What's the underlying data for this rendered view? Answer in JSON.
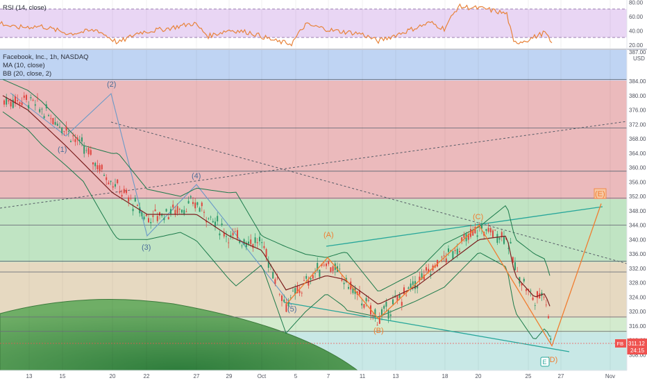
{
  "rsi_panel": {
    "title": "RSI (14, close)",
    "axis_ticks": [
      "80.00",
      "60.00",
      "40.00",
      "20.00"
    ],
    "band_upper": 70,
    "band_lower": 30,
    "colors": {
      "line": "#e8833a",
      "band_fill": "#e9d6f4",
      "band_border": "#9a7fb0"
    }
  },
  "main_panel": {
    "legend": {
      "symbol": "Facebook, Inc., 1h, NASDAQ",
      "ma": "MA (10, close)",
      "bb": "BB (20, close, 2)"
    },
    "currency": "USD",
    "price_ticks": [
      "384.00",
      "380.00",
      "376.00",
      "372.00",
      "368.00",
      "364.00",
      "360.00",
      "356.00",
      "352.00",
      "348.00",
      "344.00",
      "340.00",
      "336.00",
      "332.00",
      "328.00",
      "324.00",
      "320.00",
      "316.00",
      "312.00",
      "308.00"
    ],
    "top_partial_tick": "387.00",
    "x_ticks": [
      "13",
      "15",
      "20",
      "22",
      "27",
      "29",
      "Oct",
      "5",
      "7",
      "11",
      "13",
      "18",
      "20",
      "25",
      "27",
      "Nov"
    ],
    "last_price": {
      "ticker": "FB",
      "value": "311.12",
      "countdown": "24:15"
    },
    "wave_labels": [
      "(1)",
      "(2)",
      "(3)",
      "(4)",
      "(5)",
      "(A)",
      "(B)",
      "(C)",
      "(D)",
      "(E)"
    ],
    "earnings_marker": "E"
  },
  "chart_data": {
    "type": "line",
    "title": "Facebook, Inc., 1h, NASDAQ",
    "ylabel": "USD",
    "ylim": [
      306.5,
      386.5
    ],
    "x": [
      "13",
      "15",
      "20",
      "22",
      "27",
      "29",
      "Oct",
      "5",
      "7",
      "11",
      "13",
      "18",
      "20",
      "25",
      "27",
      "Nov"
    ],
    "series": [
      {
        "name": "price",
        "values": [
          378.5,
          379,
          371,
          356,
          346,
          350,
          341,
          339,
          322,
          334,
          329,
          318,
          328,
          343,
          341,
          332,
          323,
          326,
          310.5
        ]
      },
      {
        "name": "MA (10, close)",
        "values": [
          380,
          376,
          366,
          353,
          347,
          347,
          341,
          337,
          326,
          330,
          329,
          322,
          327,
          340,
          341,
          330,
          324,
          325,
          320
        ]
      }
    ],
    "wave_projection": [
      {
        "label": "(1)",
        "price": 369
      },
      {
        "label": "(2)",
        "price": 381
      },
      {
        "label": "(3)",
        "price": 343
      },
      {
        "label": "(4)",
        "price": 355
      },
      {
        "label": "(5)",
        "price": 322
      },
      {
        "label": "(A)",
        "price": 335
      },
      {
        "label": "(B)",
        "price": 318
      },
      {
        "label": "(C)",
        "price": 344
      },
      {
        "label": "(D)",
        "price": 310.5
      },
      {
        "label": "(E)",
        "price": 350
      }
    ],
    "horizontal_levels": [
      384.5,
      371,
      359,
      351.5,
      344,
      334,
      331,
      318.5,
      314.5
    ],
    "last_price": 311.12,
    "rsi_ylim": [
      16,
      90
    ],
    "grid": true
  }
}
